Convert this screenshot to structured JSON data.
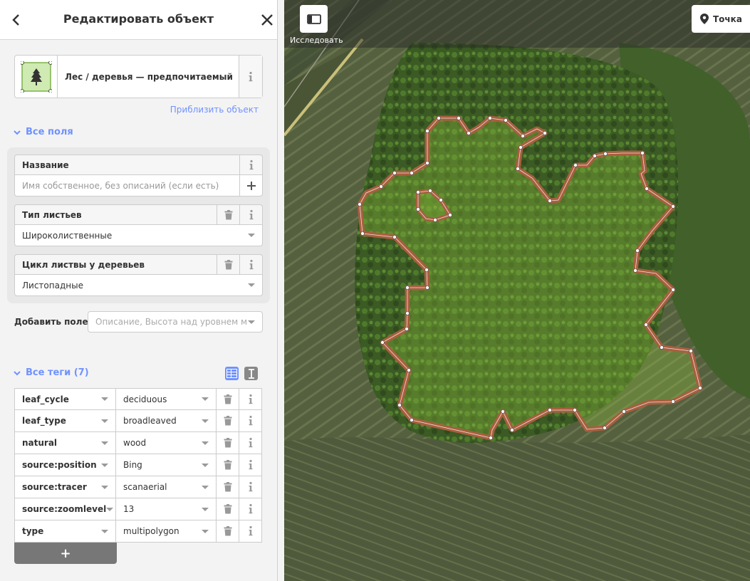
{
  "header": {
    "title": "Редактировать объект"
  },
  "preset": {
    "name": "Лес / деревья — предпочитаемый"
  },
  "zoom_link": "Приблизить объект",
  "all_fields": {
    "label": "Все поля"
  },
  "fields": {
    "name": {
      "label": "Название",
      "placeholder": "Имя собственное, без описаний (если есть)"
    },
    "leaf_type": {
      "label": "Тип листьев",
      "value": "Широколиственные"
    },
    "leaf_cycle": {
      "label": "Цикл листвы у деревьев",
      "value": "Листопадные"
    }
  },
  "add_field": {
    "label": "Добавить поле:",
    "placeholder": "Описание, Высота над уровнем мо..."
  },
  "all_tags": {
    "label": "Все теги (7)"
  },
  "tags": [
    {
      "key": "leaf_cycle",
      "value": "deciduous"
    },
    {
      "key": "leaf_type",
      "value": "broadleaved"
    },
    {
      "key": "natural",
      "value": "wood"
    },
    {
      "key": "source:position",
      "value": "Bing"
    },
    {
      "key": "source:tracer",
      "value": "scanaerial"
    },
    {
      "key": "source:zoomlevel",
      "value": "13"
    },
    {
      "key": "type",
      "value": "multipolygon"
    }
  ],
  "add_tag_label": "+",
  "map": {
    "explore_label": "Исследовать",
    "point_label": "Точка",
    "selection_color": "#b06a4f"
  },
  "colors": {
    "accent": "#7092ff",
    "info_icon": "#999999",
    "add_tag_bg": "#777777"
  }
}
